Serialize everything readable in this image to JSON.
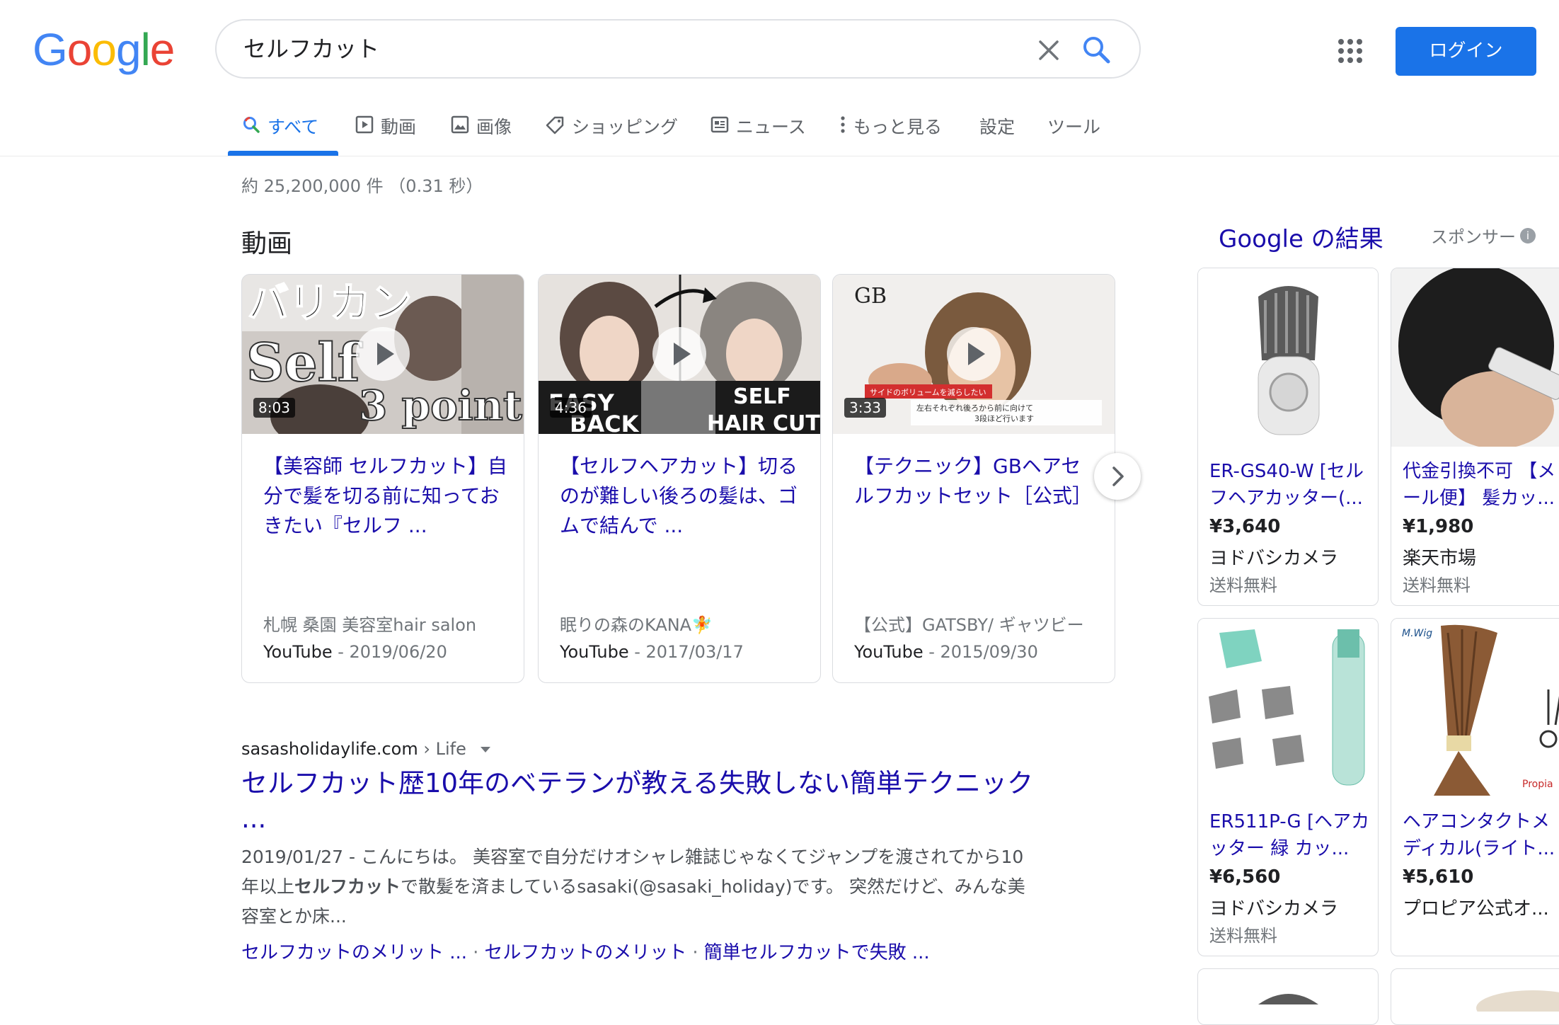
{
  "header": {
    "logo_text": "Google",
    "search_query": "セルフカット",
    "login_label": "ログイン"
  },
  "tabs": [
    {
      "label": "すべて",
      "icon": "search-icon",
      "active": true
    },
    {
      "label": "動画",
      "icon": "video-icon"
    },
    {
      "label": "画像",
      "icon": "image-icon"
    },
    {
      "label": "ショッピング",
      "icon": "tag-icon"
    },
    {
      "label": "ニュース",
      "icon": "news-icon"
    },
    {
      "label": "もっと見る",
      "icon": "more-vert-icon"
    },
    {
      "label": "設定"
    },
    {
      "label": "ツール"
    }
  ],
  "result_stats": "約 25,200,000 件 （0.31 秒）",
  "videos": {
    "heading": "動画",
    "items": [
      {
        "duration": "8:03",
        "title": "【美容師 セルフカット】自分で髪を切る前に知っておきたい『セルフ ...",
        "channel": "札幌 桑園 美容室hair salon",
        "source": "YouTube",
        "date": " - 2019/06/20",
        "thumb_text": [
          "バリカン",
          "Self",
          "3 point"
        ]
      },
      {
        "duration": "4:36",
        "title": "【セルフヘアカット】切るのが難しい後ろの髪は、ゴムで結んで ...",
        "channel": "眠りの森のKANA🧚",
        "source": "YouTube",
        "date": " - 2017/03/17",
        "thumb_text": [
          "EASY",
          "BACK",
          "SELF",
          "HAIR CUT"
        ]
      },
      {
        "duration": "3:33",
        "title": "【テクニック】GBヘアセルフカットセット［公式］",
        "channel": "【公式】GATSBY/ ギャツビー",
        "source": "YouTube",
        "date": " - 2015/09/30",
        "thumb_text": [
          "GB",
          "サイドのボリュームを減らしたい",
          "左右それぞれ後ろから前に向けて",
          "3段ほど行います"
        ]
      }
    ]
  },
  "result": {
    "domain": "sasasholidaylife.com",
    "crumb": " › Life",
    "title": "セルフカット歴10年のベテランが教える失敗しない簡単テクニック ...",
    "snippet_date": "2019/01/27 - ",
    "snippet_a": "こんにちは。 美容室で自分だけオシャレ雑誌じゃなくてジャンプを渡されてから10年以上",
    "snippet_bold": "セルフカット",
    "snippet_b": "で散髪を済ましているsasaki(@sasaki_holiday)です。 突然だけど、みんな美容室とか床...",
    "sitelinks": [
      "セルフカットのメリット ...",
      "セルフカットのメリット",
      "簡単セルフカットで失敗 ..."
    ]
  },
  "shopping": {
    "heading": "Google の結果",
    "sponsor": "スポンサー",
    "products": [
      {
        "title": "ER-GS40-W [セルフヘアカッター(...",
        "price": "¥3,640",
        "store": "ヨドバシカメラ",
        "shipping": "送料無料"
      },
      {
        "title": "代金引換不可 【メール便】 髪カッ...",
        "price": "¥1,980",
        "store": "楽天市場",
        "shipping": "送料無料"
      },
      {
        "title": "ER511P-G [ヘアカッター 緑 カッ...",
        "price": "¥6,560",
        "store": "ヨドバシカメラ",
        "shipping": "送料無料"
      },
      {
        "title": "ヘアコンタクトメディカル(ライト...",
        "price": "¥5,610",
        "store": "プロピア公式オ...",
        "shipping": ""
      }
    ],
    "product_image_text": [
      "M.Wig",
      "Propia"
    ]
  },
  "colors": {
    "link": "#1a0dab",
    "accent": "#1a73e8",
    "muted": "#70757a"
  }
}
